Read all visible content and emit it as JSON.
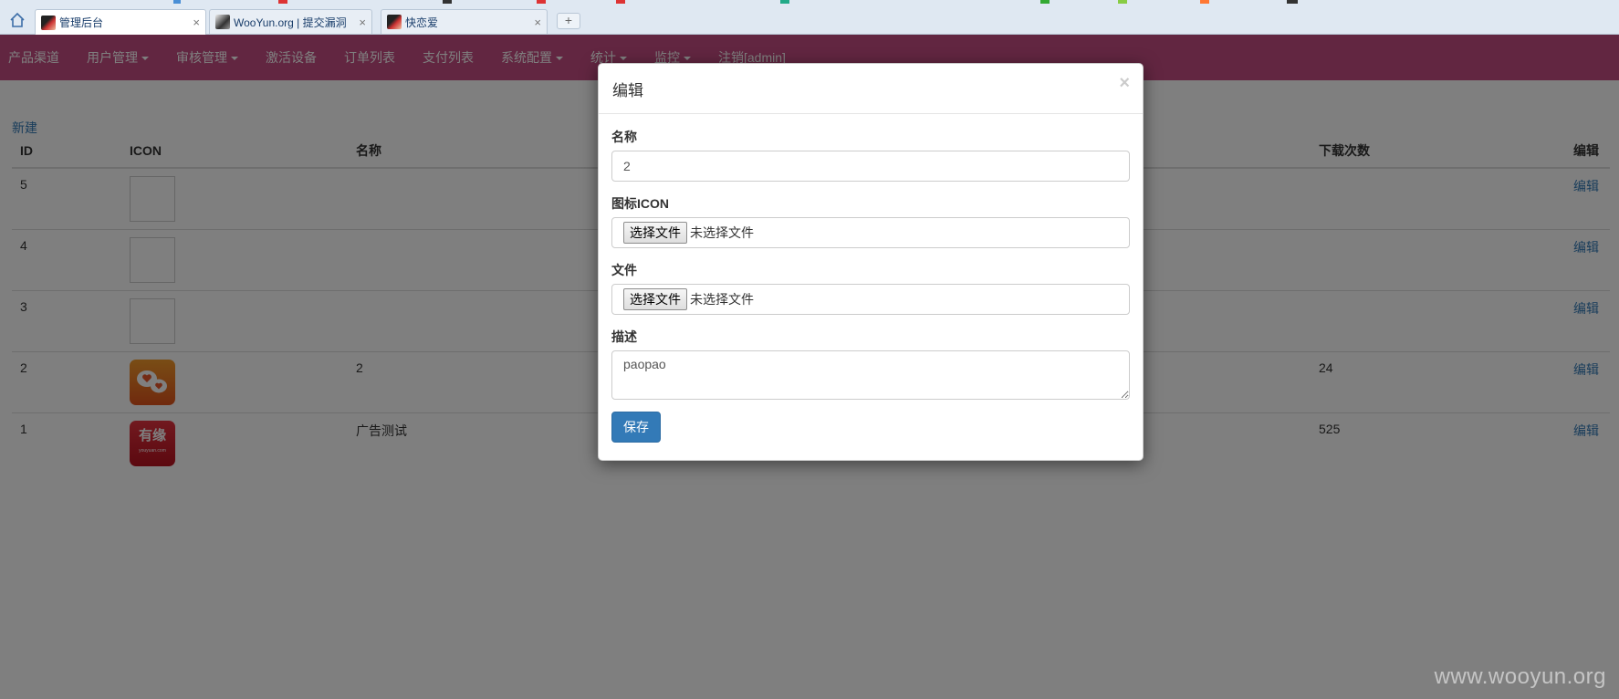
{
  "browser": {
    "tabs": [
      {
        "label": "管理后台",
        "close": "×"
      },
      {
        "label": "WooYun.org | 提交漏洞",
        "close": "×"
      },
      {
        "label": "快恋爱",
        "close": "×"
      }
    ],
    "new_tab": "+"
  },
  "navbar": {
    "items": [
      {
        "label": "产品渠道",
        "dropdown": false
      },
      {
        "label": "用户管理",
        "dropdown": true
      },
      {
        "label": "审核管理",
        "dropdown": true
      },
      {
        "label": "激活设备",
        "dropdown": false
      },
      {
        "label": "订单列表",
        "dropdown": false
      },
      {
        "label": "支付列表",
        "dropdown": false
      },
      {
        "label": "系统配置",
        "dropdown": true
      },
      {
        "label": "统计",
        "dropdown": true
      },
      {
        "label": "监控",
        "dropdown": true
      },
      {
        "label": "注销[admin]",
        "dropdown": false
      }
    ]
  },
  "main": {
    "new_link": "新建",
    "columns": {
      "id": "ID",
      "icon": "ICON",
      "name": "名称",
      "downloads": "下载次数",
      "edit": "编辑"
    },
    "rows": [
      {
        "id": "5",
        "icon": "empty",
        "name": "",
        "downloads": "",
        "edit": "编辑"
      },
      {
        "id": "4",
        "icon": "empty",
        "name": "",
        "downloads": "",
        "edit": "编辑"
      },
      {
        "id": "3",
        "icon": "empty",
        "name": "",
        "downloads": "",
        "edit": "编辑"
      },
      {
        "id": "2",
        "icon": "orange-chat-icon",
        "name": "2",
        "downloads": "24",
        "edit": "编辑"
      },
      {
        "id": "1",
        "icon": "youyuan-logo",
        "name": "广告测试",
        "downloads": "525",
        "edit": "编辑"
      }
    ],
    "youyuan_logo_text": "有缘",
    "youyuan_logo_sub": "youyuan.com"
  },
  "modal": {
    "title": "编辑",
    "close": "×",
    "name_label": "名称",
    "name_value": "2",
    "icon_label": "图标ICON",
    "file_label": "文件",
    "choose_file_button": "选择文件",
    "no_file_text": "未选择文件",
    "desc_label": "描述",
    "desc_value": "paopao",
    "save_button": "保存"
  },
  "watermark": "www.wooyun.org",
  "colors": {
    "navbar": "#c54d82",
    "link": "#337ab7",
    "primary": "#337ab7"
  }
}
